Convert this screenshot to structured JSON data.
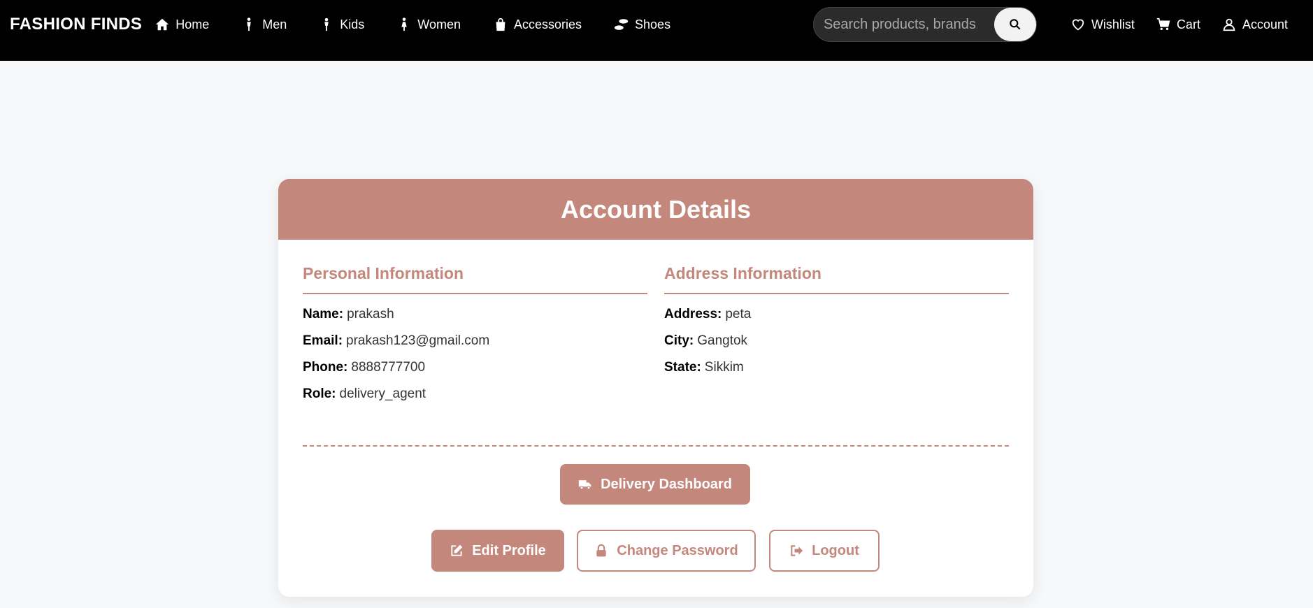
{
  "navbar": {
    "brand": "FASHION FINDS",
    "links": [
      {
        "label": "Home",
        "icon": "home-icon"
      },
      {
        "label": "Men",
        "icon": "person-icon"
      },
      {
        "label": "Kids",
        "icon": "child-icon"
      },
      {
        "label": "Women",
        "icon": "woman-icon"
      },
      {
        "label": "Accessories",
        "icon": "shopping-bag-icon"
      },
      {
        "label": "Shoes",
        "icon": "shoe-prints-icon"
      }
    ],
    "search": {
      "placeholder": "Search products, brands, and more..."
    },
    "wishlist_label": "Wishlist",
    "cart_label": "Cart",
    "account_label": "Account"
  },
  "account": {
    "title": "Account Details",
    "personal": {
      "heading": "Personal Information",
      "fields": [
        {
          "label": "Name:",
          "value": "prakash"
        },
        {
          "label": "Email:",
          "value": "prakash123@gmail.com"
        },
        {
          "label": "Phone:",
          "value": "8888777700"
        },
        {
          "label": "Role:",
          "value": "delivery_agent"
        }
      ]
    },
    "address": {
      "heading": "Address Information",
      "fields": [
        {
          "label": "Address:",
          "value": "peta"
        },
        {
          "label": "City:",
          "value": "Gangtok"
        },
        {
          "label": "State:",
          "value": "Sikkim"
        }
      ]
    },
    "buttons": {
      "delivery": "Delivery Dashboard",
      "edit": "Edit Profile",
      "password": "Change Password",
      "logout": "Logout"
    }
  },
  "colors": {
    "accent": "#c4877b",
    "navbar_bg": "#000000",
    "page_bg": "#f7f8fa"
  }
}
